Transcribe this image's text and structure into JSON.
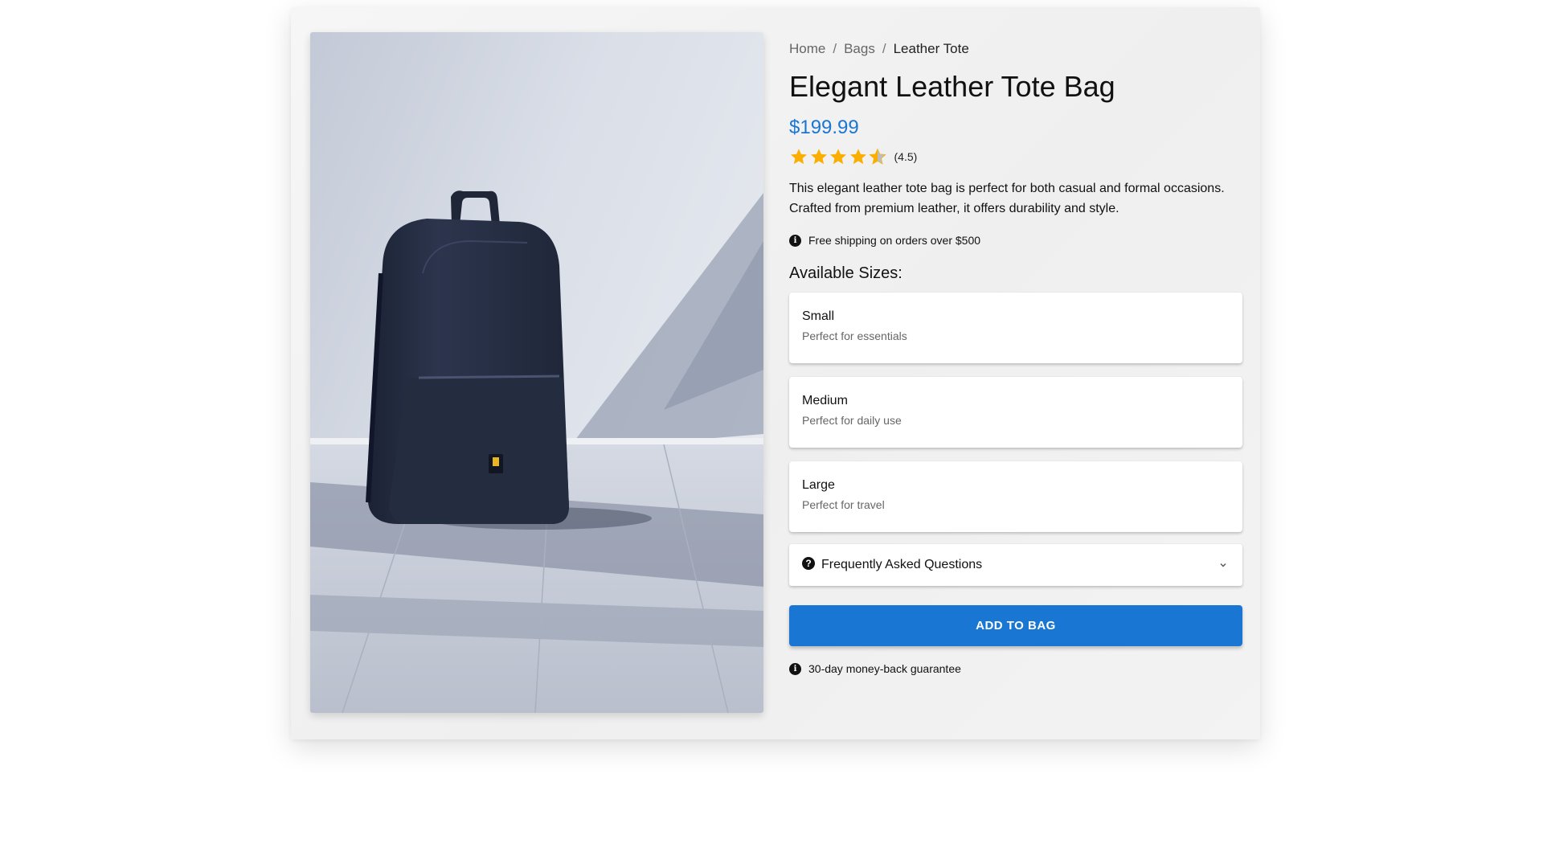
{
  "breadcrumb": {
    "home": "Home",
    "category": "Bags",
    "current": "Leather Tote"
  },
  "product": {
    "title": "Elegant Leather Tote Bag",
    "price": "$199.99",
    "rating": 4.5,
    "rating_label": "(4.5)",
    "description": "This elegant leather tote bag is perfect for both casual and formal occasions. Crafted from premium leather, it offers durability and style.",
    "image_icon": "product-photo-backpack"
  },
  "shipping_notice": "Free shipping on orders over $500",
  "sizes_heading": "Available Sizes:",
  "sizes": [
    {
      "name": "Small",
      "description": "Perfect for essentials"
    },
    {
      "name": "Medium",
      "description": "Perfect for daily use"
    },
    {
      "name": "Large",
      "description": "Perfect for travel"
    }
  ],
  "faq": {
    "label": "Frequently Asked Questions",
    "icon": "help-circle-icon",
    "expand_icon": "chevron-down-icon"
  },
  "add_button": "ADD TO BAG",
  "guarantee_notice": "30-day money-back guarantee",
  "colors": {
    "accent": "#1976d2",
    "star": "#faaf00",
    "star_empty": "#bdbdbd"
  }
}
